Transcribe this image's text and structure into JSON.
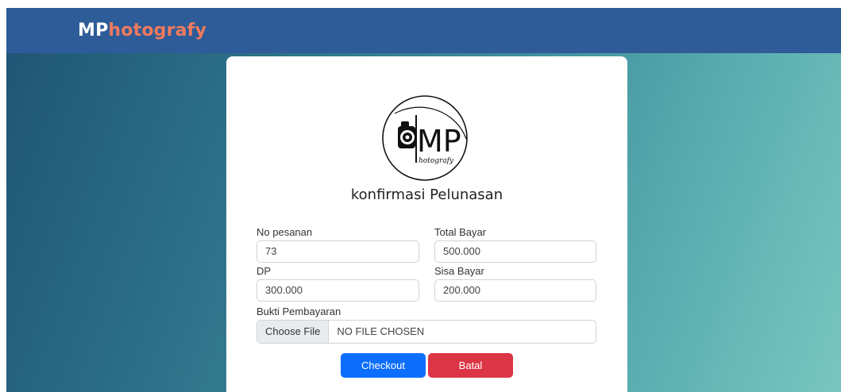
{
  "navbar": {
    "brand_part1": "MP",
    "brand_part2": "hotografy",
    "brand_color_primary": "#ffffff",
    "brand_color_accent": "#f07a5e"
  },
  "logo": {
    "icon": "camera-logo-icon",
    "text_main": "MP",
    "text_script": "hotografy"
  },
  "form": {
    "title": "konfirmasi Pelunasan",
    "no_pesanan_label": "No pesanan",
    "no_pesanan_value": "73",
    "total_bayar_label": "Total Bayar",
    "total_bayar_value": "500.000",
    "dp_label": "DP",
    "dp_value": "300.000",
    "sisa_bayar_label": "Sisa Bayar",
    "sisa_bayar_value": "200.000",
    "bukti_label": "Bukti Pembayaran",
    "choose_file_label": "Choose File",
    "no_file_text": "NO FILE CHOSEN"
  },
  "buttons": {
    "checkout": "Checkout",
    "batal": "Batal"
  },
  "colors": {
    "navbar": "#2e5c98",
    "checkout": "#0d6efd",
    "batal": "#dc3545"
  }
}
